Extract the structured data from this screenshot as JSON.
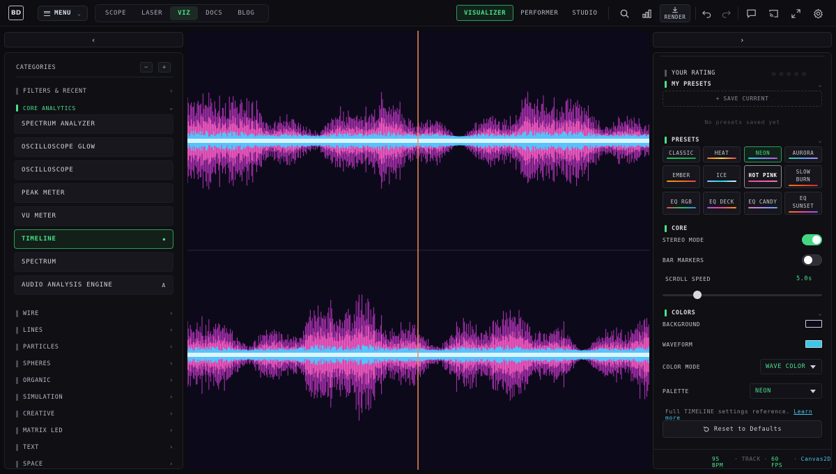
{
  "topbar": {
    "logo_text": "BD",
    "menu_label": "MENU",
    "nav": [
      {
        "label": "SCOPE",
        "active": false
      },
      {
        "label": "LASER",
        "active": false
      },
      {
        "label": "VIZ",
        "active": true
      },
      {
        "label": "DOCS",
        "active": false
      },
      {
        "label": "BLOG",
        "active": false
      }
    ],
    "modes": [
      {
        "label": "VISUALIZER",
        "active": true
      },
      {
        "label": "PERFORMER",
        "active": false
      },
      {
        "label": "STUDIO",
        "active": false
      }
    ],
    "render_label": "RENDER"
  },
  "sidebar": {
    "categories_label": "CATEGORIES",
    "groups_top": [
      {
        "label": "FILTERS & RECENT"
      },
      {
        "label": "CORE ANALYTICS",
        "open": true
      }
    ],
    "items": [
      {
        "label": "SPECTRUM ANALYZER",
        "tag": ""
      },
      {
        "label": "OSCILLOSCOPE GLOW",
        "tag": ""
      },
      {
        "label": "OSCILLOSCOPE",
        "tag": ""
      },
      {
        "label": "PEAK METER",
        "tag": ""
      },
      {
        "label": "VU METER",
        "tag": ""
      },
      {
        "label": "TIMELINE",
        "tag": "●",
        "active": true
      },
      {
        "label": "SPECTRUM",
        "tag": ""
      },
      {
        "label": "AUDIO ANALYSIS ENGINE",
        "tag": "A"
      }
    ],
    "groups_bottom": [
      {
        "label": "WIRE"
      },
      {
        "label": "LINES"
      },
      {
        "label": "PARTICLES"
      },
      {
        "label": "SPHERES"
      },
      {
        "label": "ORGANIC"
      },
      {
        "label": "SIMULATION"
      },
      {
        "label": "CREATIVE"
      },
      {
        "label": "MATRIX LED"
      },
      {
        "label": "TEXT"
      },
      {
        "label": "SPACE"
      }
    ]
  },
  "right": {
    "your_rating": "YOUR RATING",
    "rating_value": 0,
    "rating_max": 5,
    "my_presets": "MY PRESETS",
    "save_current": "+ SAVE CURRENT",
    "no_presets": "No presets saved yet",
    "presets_label": "PRESETS",
    "presets": [
      {
        "label": "CLASSIC",
        "colors": [
          "#22c55e",
          "#16a34a"
        ]
      },
      {
        "label": "HEAT",
        "colors": [
          "#f97316",
          "#fde047",
          "#ef4444"
        ]
      },
      {
        "label": "NEON",
        "colors": [
          "#22d3ee",
          "#d946ef"
        ],
        "active": true
      },
      {
        "label": "AURORA",
        "colors": [
          "#34d399",
          "#60a5fa",
          "#a78bfa"
        ]
      },
      {
        "label": "EMBER",
        "colors": [
          "#f59e0b",
          "#ef4444"
        ]
      },
      {
        "label": "ICE",
        "colors": [
          "#93c5fd",
          "#22d3ee",
          "#e0f2fe"
        ]
      },
      {
        "label": "HOT PINK",
        "colors": [
          "#ec4899",
          "#f472b6"
        ],
        "hot": true
      },
      {
        "label": "SLOW\nBURN",
        "colors": [
          "#f97316",
          "#dc2626"
        ]
      },
      {
        "label": "EQ RGB",
        "colors": [
          "#ef4444",
          "#22c55e",
          "#3b82f6"
        ]
      },
      {
        "label": "EQ DECK",
        "colors": [
          "#a855f7",
          "#ec4899",
          "#f59e0b"
        ]
      },
      {
        "label": "EQ CANDY",
        "colors": [
          "#f472b6",
          "#a78bfa",
          "#60a5fa"
        ]
      },
      {
        "label": "EQ\nSUNSET",
        "colors": [
          "#f97316",
          "#ec4899",
          "#8b5cf6"
        ]
      }
    ],
    "core_label": "CORE",
    "stereo_mode": "STEREO MODE",
    "stereo_on": true,
    "bar_markers": "BAR MARKERS",
    "bar_markers_on": false,
    "scroll_speed": "SCROLL SPEED",
    "scroll_speed_value": "5.0s",
    "scroll_speed_fraction": 0.22,
    "colors_label": "COLORS",
    "background_label": "BACKGROUND",
    "background_color": "#0c0a1a",
    "waveform_label": "WAVEFORM",
    "waveform_color": "#38c8ec",
    "color_mode_label": "COLOR MODE",
    "color_mode_value": "WAVE COLOR",
    "palette_label": "PALETTE",
    "palette_value": "NEON",
    "full_ref": "Full TIMELINE settings reference.",
    "learn_more": "Learn more",
    "reset": "Reset to Defaults",
    "status": {
      "bpm": "95 BPM",
      "sep": "·",
      "track": "TRACK",
      "fps": "60 FPS",
      "engine": "Canvas2D"
    }
  },
  "colors": {
    "accent": "#4be08a",
    "playhead": "#f08a5d",
    "wave_outer": "#d43bd8",
    "wave_mid": "#ff5fc8",
    "wave_inner": "#4fc8ff",
    "wave_core": "#e8fbff"
  }
}
